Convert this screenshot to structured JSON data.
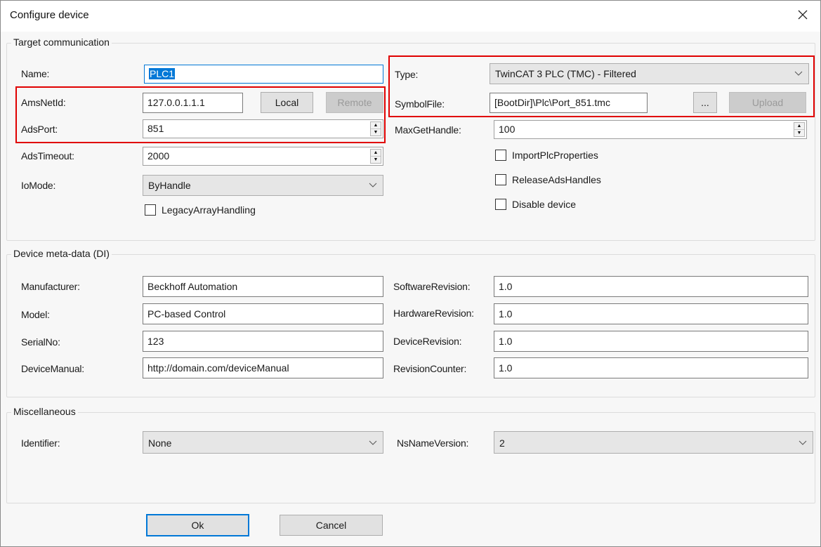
{
  "window": {
    "title": "Configure device",
    "close_icon": "close-icon"
  },
  "target_communication": {
    "legend": "Target communication",
    "name": {
      "label": "Name:",
      "value": "PLC1"
    },
    "ams_net_id": {
      "label": "AmsNetId:",
      "value": "127.0.0.1.1.1",
      "local_button": "Local",
      "remote_button": "Remote"
    },
    "ads_port": {
      "label": "AdsPort:",
      "value": "851"
    },
    "ads_timeout": {
      "label": "AdsTimeout:",
      "value": "2000"
    },
    "io_mode": {
      "label": "IoMode:",
      "value": "ByHandle"
    },
    "legacy_array_handling": {
      "label": "LegacyArrayHandling",
      "checked": false
    },
    "type": {
      "label": "Type:",
      "value": "TwinCAT 3 PLC (TMC) - Filtered"
    },
    "symbol_file": {
      "label": "SymbolFile:",
      "value": "[BootDir]\\Plc\\Port_851.tmc",
      "browse_button": "...",
      "upload_button": "Upload"
    },
    "max_get_handle": {
      "label": "MaxGetHandle:",
      "value": "100"
    },
    "import_plc_properties": {
      "label": "ImportPlcProperties",
      "checked": false
    },
    "release_ads_handles": {
      "label": "ReleaseAdsHandles",
      "checked": false
    },
    "disable_device": {
      "label": "Disable device",
      "checked": false
    }
  },
  "device_meta": {
    "legend": "Device meta-data (DI)",
    "manufacturer": {
      "label": "Manufacturer:",
      "value": "Beckhoff Automation"
    },
    "model": {
      "label": "Model:",
      "value": "PC-based Control"
    },
    "serial_no": {
      "label": "SerialNo:",
      "value": "123"
    },
    "device_manual": {
      "label": "DeviceManual:",
      "value": "http://domain.com/deviceManual"
    },
    "software_revision": {
      "label": "SoftwareRevision:",
      "value": "1.0"
    },
    "hardware_revision": {
      "label": "HardwareRevision:",
      "value": "1.0"
    },
    "device_revision": {
      "label": "DeviceRevision:",
      "value": "1.0"
    },
    "revision_counter": {
      "label": "RevisionCounter:",
      "value": "1.0"
    }
  },
  "miscellaneous": {
    "legend": "Miscellaneous",
    "identifier": {
      "label": "Identifier:",
      "value": "None"
    },
    "ns_name_version": {
      "label": "NsNameVersion:",
      "value": "2"
    }
  },
  "footer": {
    "ok_button": "Ok",
    "cancel_button": "Cancel"
  },
  "colors": {
    "highlight_border": "#e00000",
    "focus_accent": "#0078d7"
  }
}
